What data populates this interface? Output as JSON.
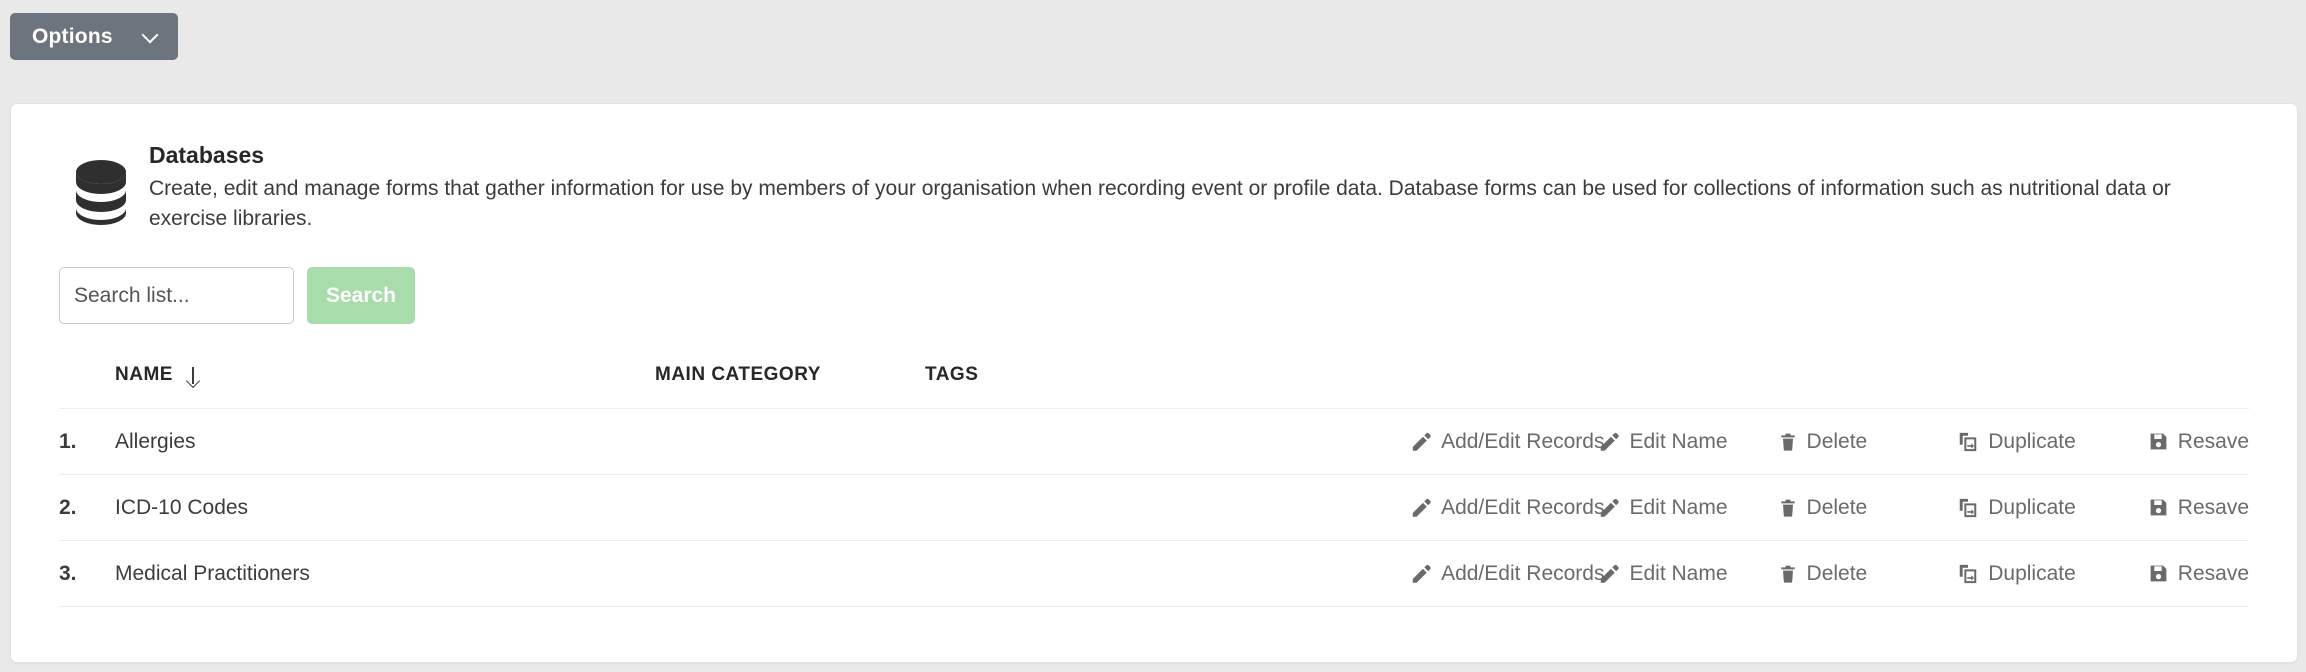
{
  "toolbar": {
    "options_label": "Options",
    "chevron_icon": "chevron-down-icon"
  },
  "card": {
    "icon": "database-icon",
    "title": "Databases",
    "description": "Create, edit and manage forms that gather information for use by members of your organisation when recording event or profile data. Database forms can be used for collections of information such as nutritional data or exercise libraries."
  },
  "search": {
    "placeholder": "Search list...",
    "value": "",
    "button_label": "Search",
    "button_color": "#a8dcab"
  },
  "table": {
    "headers": {
      "index": "",
      "name": "NAME",
      "sort_icon": "sort-arrow-down-icon",
      "main_category": "MAIN CATEGORY",
      "tags": "TAGS",
      "actions": ""
    },
    "rows": [
      {
        "index": "1.",
        "name": "Allergies",
        "main_category": "",
        "tags": ""
      },
      {
        "index": "2.",
        "name": "ICD-10 Codes",
        "main_category": "",
        "tags": ""
      },
      {
        "index": "3.",
        "name": "Medical Practitioners",
        "main_category": "",
        "tags": ""
      }
    ],
    "actions": {
      "add_edit_records": "Add/Edit Records",
      "edit_name": "Edit Name",
      "delete": "Delete",
      "duplicate": "Duplicate",
      "resave": "Resave"
    }
  },
  "colors": {
    "page_background": "#e9e9e9",
    "card_background": "#ffffff",
    "options_button": "#6c757d",
    "search_button": "#a8dcab",
    "text_primary": "#272727",
    "text_secondary": "#3c3c3c",
    "action_text": "#6a6a6a"
  }
}
